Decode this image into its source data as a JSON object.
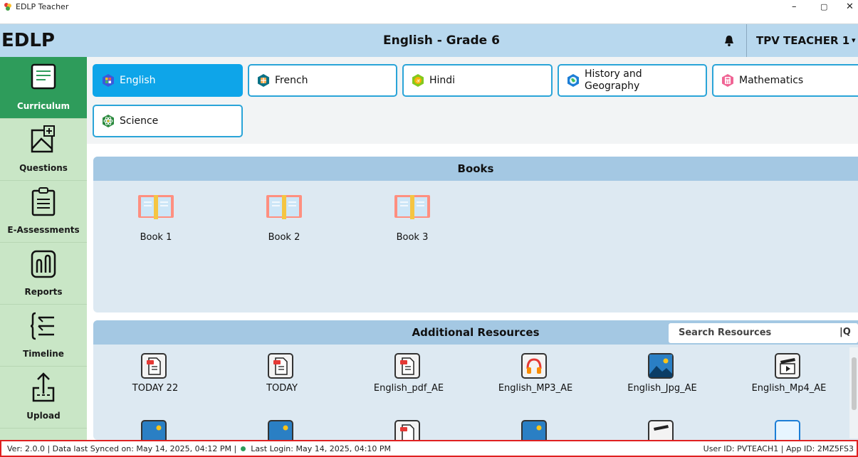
{
  "window": {
    "title": "EDLP Teacher",
    "minimize": "–",
    "restore": "▢",
    "close": "✕"
  },
  "header": {
    "brand": "EDLP",
    "title": "English - Grade 6",
    "user": "TPV TEACHER 1",
    "bell_icon": "bell-icon"
  },
  "sidebar": {
    "items": [
      {
        "label": "Curriculum",
        "icon": "curriculum-icon",
        "active": true
      },
      {
        "label": "Questions",
        "icon": "questions-icon"
      },
      {
        "label": "E-Assessments",
        "icon": "e-assessments-icon"
      },
      {
        "label": "Reports",
        "icon": "reports-icon"
      },
      {
        "label": "Timeline",
        "icon": "timeline-icon"
      },
      {
        "label": "Upload",
        "icon": "upload-icon"
      }
    ]
  },
  "subjects": [
    {
      "label": "English",
      "active": true
    },
    {
      "label": "French"
    },
    {
      "label": "Hindi"
    },
    {
      "label": "History and Geography"
    },
    {
      "label": "Mathematics"
    },
    {
      "label": "Science"
    }
  ],
  "books": {
    "title": "Books",
    "items": [
      "Book 1",
      "Book 2",
      "Book 3"
    ]
  },
  "resources": {
    "title": "Additional Resources",
    "search_placeholder": "Search Resources",
    "items": [
      "TODAY 22",
      "TODAY",
      "English_pdf_AE",
      "English_MP3_AE",
      "English_Jpg_AE",
      "English_Mp4_AE"
    ]
  },
  "status": {
    "version": "Ver: 2.0.0",
    "synced": "Data last Synced on: May 14, 2025, 04:12 PM",
    "login": "Last Login: May 14, 2025, 04:10 PM",
    "user_id": "User ID: PVTEACH1",
    "app_id": "App ID: 2MZ5FS3"
  },
  "colors": {
    "accent": "#0ea5e9",
    "sidebar_active": "#2e9c5b",
    "sidebar_bg": "#c9e6c6",
    "header_bg": "#b8d8ee",
    "status_border": "#e02020"
  }
}
